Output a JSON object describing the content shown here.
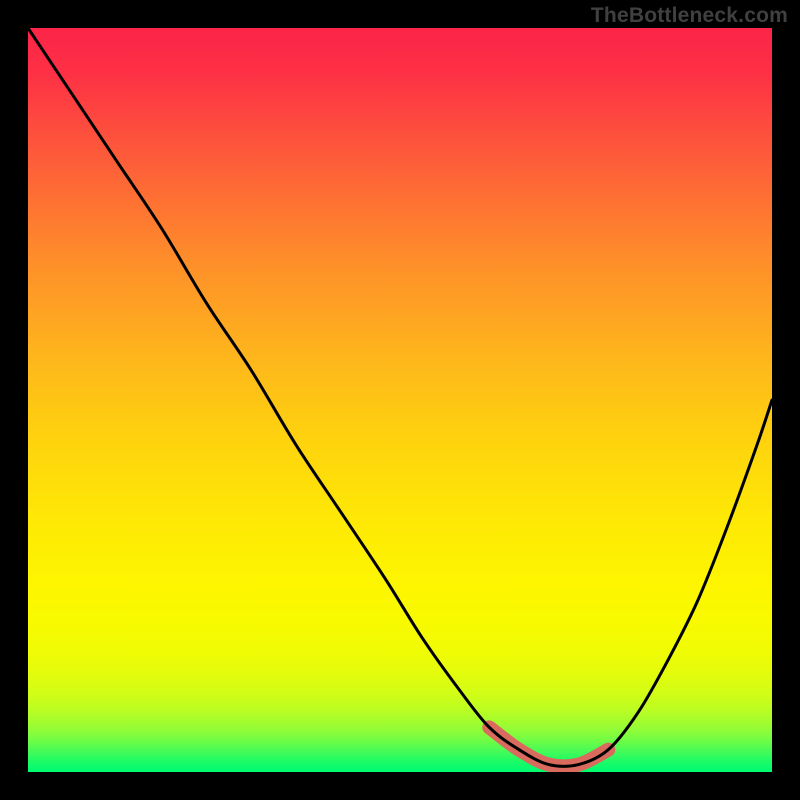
{
  "watermark": "TheBottleneck.com",
  "accent_color": "#d96a5d",
  "chart_data": {
    "type": "line",
    "title": "",
    "xlabel": "",
    "ylabel": "",
    "xlim": [
      0,
      100
    ],
    "ylim": [
      0,
      100
    ],
    "series": [
      {
        "name": "bottleneck-curve",
        "x": [
          0,
          6,
          12,
          18,
          24,
          30,
          36,
          42,
          48,
          53,
          58,
          62,
          66,
          70,
          74,
          78,
          82,
          86,
          90,
          94,
          98,
          100
        ],
        "y": [
          100,
          91,
          82,
          73,
          63,
          54,
          44,
          35,
          26,
          18,
          11,
          6,
          3,
          1,
          1,
          3,
          8,
          15,
          23,
          33,
          44,
          50
        ]
      },
      {
        "name": "optimal-range",
        "x": [
          62,
          66,
          70,
          74,
          78
        ],
        "y": [
          6,
          3,
          1,
          1,
          3
        ]
      }
    ]
  }
}
